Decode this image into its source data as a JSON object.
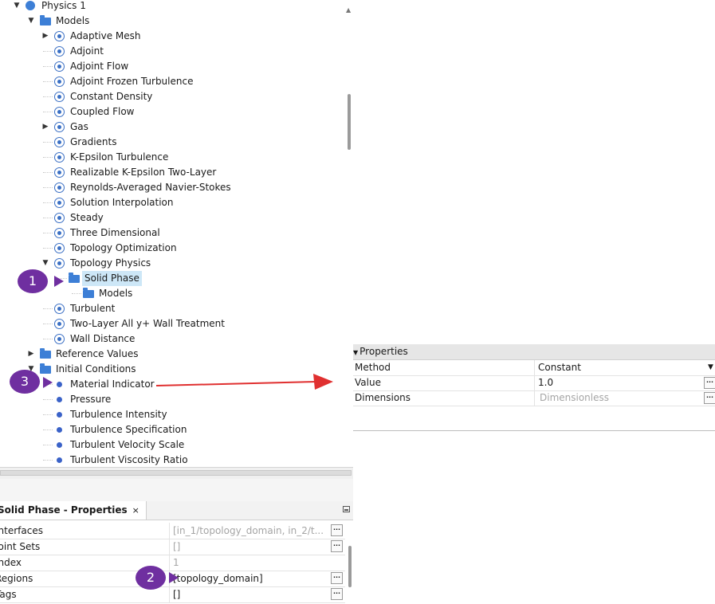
{
  "tree": {
    "items": [
      {
        "label": "Physics 1",
        "icon": "physics-icon",
        "level": 0,
        "expanded": true
      },
      {
        "label": "Models",
        "icon": "folder-icon",
        "level": 1,
        "expanded": true
      },
      {
        "label": "Adaptive Mesh",
        "icon": "model-icon",
        "level": 2,
        "expandable": true
      },
      {
        "label": "Adjoint",
        "icon": "model-icon",
        "level": 2
      },
      {
        "label": "Adjoint Flow",
        "icon": "model-icon",
        "level": 2
      },
      {
        "label": "Adjoint Frozen Turbulence",
        "icon": "model-icon",
        "level": 2
      },
      {
        "label": "Constant Density",
        "icon": "model-icon",
        "level": 2
      },
      {
        "label": "Coupled Flow",
        "icon": "model-icon",
        "level": 2
      },
      {
        "label": "Gas",
        "icon": "model-icon",
        "level": 2,
        "expandable": true
      },
      {
        "label": "Gradients",
        "icon": "model-icon",
        "level": 2
      },
      {
        "label": "K-Epsilon Turbulence",
        "icon": "model-icon",
        "level": 2
      },
      {
        "label": "Realizable K-Epsilon Two-Layer",
        "icon": "model-icon",
        "level": 2
      },
      {
        "label": "Reynolds-Averaged Navier-Stokes",
        "icon": "model-icon",
        "level": 2
      },
      {
        "label": "Solution Interpolation",
        "icon": "model-icon",
        "level": 2
      },
      {
        "label": "Steady",
        "icon": "model-icon",
        "level": 2
      },
      {
        "label": "Three Dimensional",
        "icon": "model-icon",
        "level": 2
      },
      {
        "label": "Topology Optimization",
        "icon": "model-icon",
        "level": 2
      },
      {
        "label": "Topology Physics",
        "icon": "model-icon",
        "level": 2,
        "expanded": true
      },
      {
        "label": "Solid Phase",
        "icon": "folder-icon",
        "level": 3,
        "selected": true
      },
      {
        "label": "Models",
        "icon": "folder-icon",
        "level": 4
      },
      {
        "label": "Turbulent",
        "icon": "model-icon",
        "level": 2
      },
      {
        "label": "Two-Layer All y+ Wall Treatment",
        "icon": "model-icon",
        "level": 2
      },
      {
        "label": "Wall Distance",
        "icon": "model-icon",
        "level": 2
      },
      {
        "label": "Reference Values",
        "icon": "folder-icon",
        "level": 1,
        "expandable": true
      },
      {
        "label": "Initial Conditions",
        "icon": "folder-icon",
        "level": 1,
        "expanded": true
      },
      {
        "label": "Material Indicator",
        "icon": "dot-icon",
        "level": 2
      },
      {
        "label": "Pressure",
        "icon": "dot-icon",
        "level": 2
      },
      {
        "label": "Turbulence Intensity",
        "icon": "dot-icon",
        "level": 2
      },
      {
        "label": "Turbulence Specification",
        "icon": "dot-icon",
        "level": 2
      },
      {
        "label": "Turbulent Velocity Scale",
        "icon": "dot-icon",
        "level": 2
      },
      {
        "label": "Turbulent Viscosity Ratio",
        "icon": "dot-icon",
        "level": 2
      }
    ]
  },
  "bottom_panel": {
    "tab_title": "Solid Phase - Properties",
    "close_glyph": "×",
    "rows": [
      {
        "name": "Interfaces",
        "value": "[in_1/topology_domain, in_2/t...",
        "muted": true,
        "button": true
      },
      {
        "name": "Joint Sets",
        "value": "[]",
        "muted": true,
        "button": true
      },
      {
        "name": "Index",
        "value": "1",
        "muted": true,
        "button": false
      },
      {
        "name": "Regions",
        "value": "[topology_domain]",
        "muted": false,
        "button": true
      },
      {
        "name": "Tags",
        "value": "[]",
        "muted": false,
        "button": true
      }
    ]
  },
  "right_panel": {
    "header": "Properties",
    "rows": [
      {
        "name": "Method",
        "value": "Constant",
        "muted": false,
        "dropdown": true
      },
      {
        "name": "Value",
        "value": "1.0",
        "muted": false,
        "button": true
      },
      {
        "name": "Dimensions",
        "value": "Dimensionless",
        "muted": true,
        "button": true
      }
    ]
  },
  "callouts": [
    {
      "number": "1"
    },
    {
      "number": "2"
    },
    {
      "number": "3"
    }
  ],
  "colors": {
    "callout": "#6f2fa0",
    "arrow": "#e03030",
    "selection": "#cde7f7",
    "icon_blue": "#3a6fc4"
  },
  "glyphs": {
    "ellipsis": "...",
    "dropdown": "▼",
    "expanded": "▼",
    "collapsed": "▶",
    "scroll_up": "▲"
  }
}
